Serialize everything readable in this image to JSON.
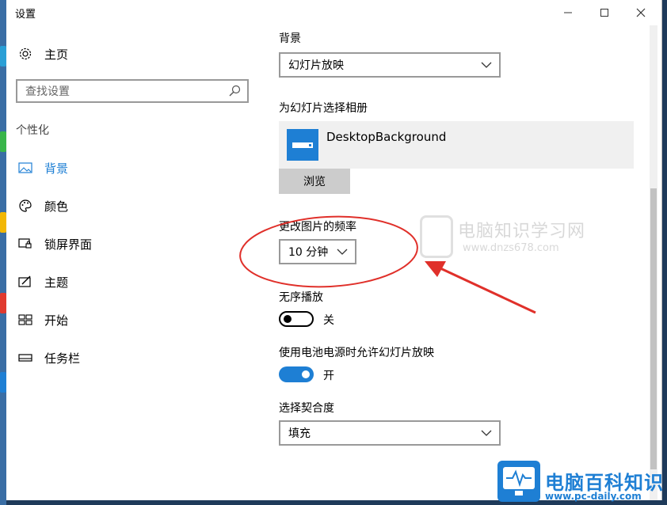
{
  "window": {
    "title": "设置"
  },
  "sidebar": {
    "home_label": "主页",
    "search_placeholder": "查找设置",
    "section_label": "个性化",
    "items": [
      {
        "label": "背景",
        "icon": "image-icon",
        "selected": true
      },
      {
        "label": "颜色",
        "icon": "palette-icon"
      },
      {
        "label": "锁屏界面",
        "icon": "lock-screen-icon"
      },
      {
        "label": "主题",
        "icon": "theme-icon"
      },
      {
        "label": "开始",
        "icon": "start-icon"
      },
      {
        "label": "任务栏",
        "icon": "taskbar-icon"
      }
    ]
  },
  "main": {
    "background_label": "背景",
    "background_value": "幻灯片放映",
    "album_label": "为幻灯片选择相册",
    "album_name": "DesktopBackground",
    "browse_label": "浏览",
    "frequency_label": "更改图片的频率",
    "frequency_value": "10 分钟",
    "shuffle_label": "无序播放",
    "shuffle_state": "关",
    "battery_label": "使用电池电源时允许幻灯片放映",
    "battery_state": "开",
    "fit_label": "选择契合度",
    "fit_value": "填充"
  },
  "watermark": {
    "name": "电脑知识学习网",
    "url": "www.dnzs678.com"
  },
  "logo": {
    "name": "电脑百科知识",
    "url": "www.pc-daily.com"
  },
  "colors": {
    "accent": "#1e7fd4",
    "annotation": "#e0302a"
  }
}
